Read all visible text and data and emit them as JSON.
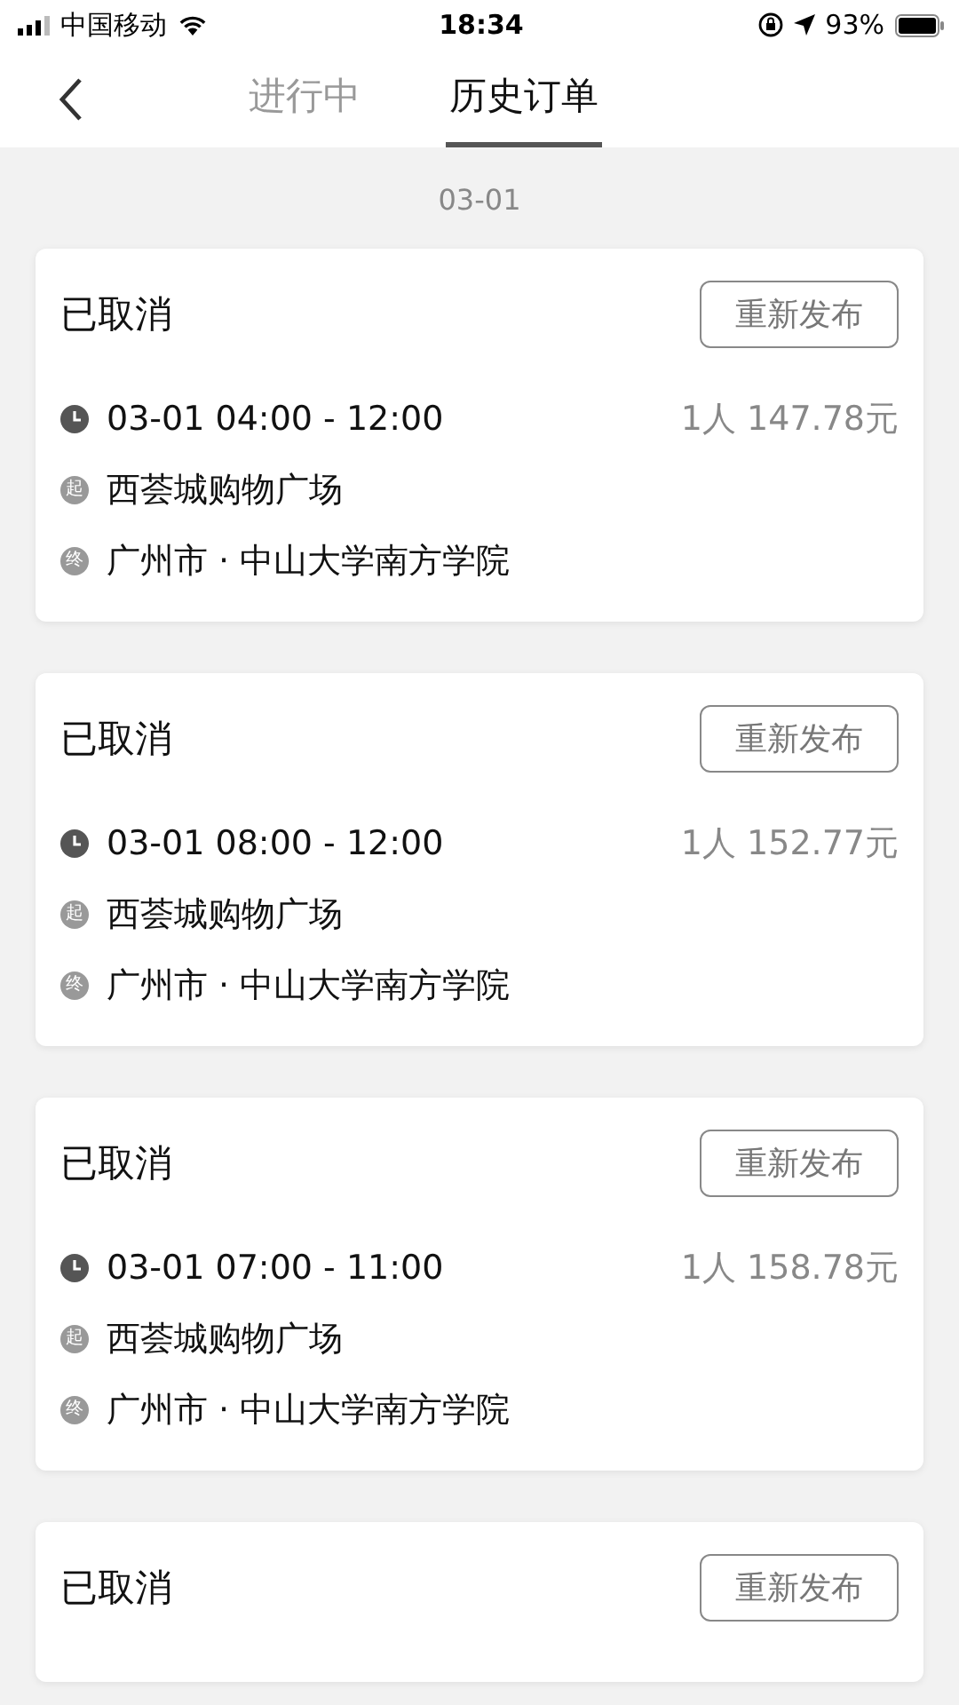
{
  "status_bar": {
    "carrier": "中国移动",
    "time": "18:34",
    "battery": "93%"
  },
  "nav": {
    "tabs": [
      {
        "label": "进行中",
        "selected": false
      },
      {
        "label": "历史订单",
        "selected": true
      }
    ]
  },
  "date_header": "03-01",
  "orders": [
    {
      "status": "已取消",
      "action": "重新发布",
      "time": "03-01 04:00 - 12:00",
      "price": "1人 147.78元",
      "start_mark": "起",
      "start": "西荟城购物广场",
      "end_mark": "终",
      "end": "广州市 · 中山大学南方学院"
    },
    {
      "status": "已取消",
      "action": "重新发布",
      "time": "03-01 08:00 - 12:00",
      "price": "1人 152.77元",
      "start_mark": "起",
      "start": "西荟城购物广场",
      "end_mark": "终",
      "end": "广州市 · 中山大学南方学院"
    },
    {
      "status": "已取消",
      "action": "重新发布",
      "time": "03-01 07:00 - 11:00",
      "price": "1人 158.78元",
      "start_mark": "起",
      "start": "西荟城购物广场",
      "end_mark": "终",
      "end": "广州市 · 中山大学南方学院"
    },
    {
      "status": "已取消",
      "action": "重新发布"
    }
  ]
}
